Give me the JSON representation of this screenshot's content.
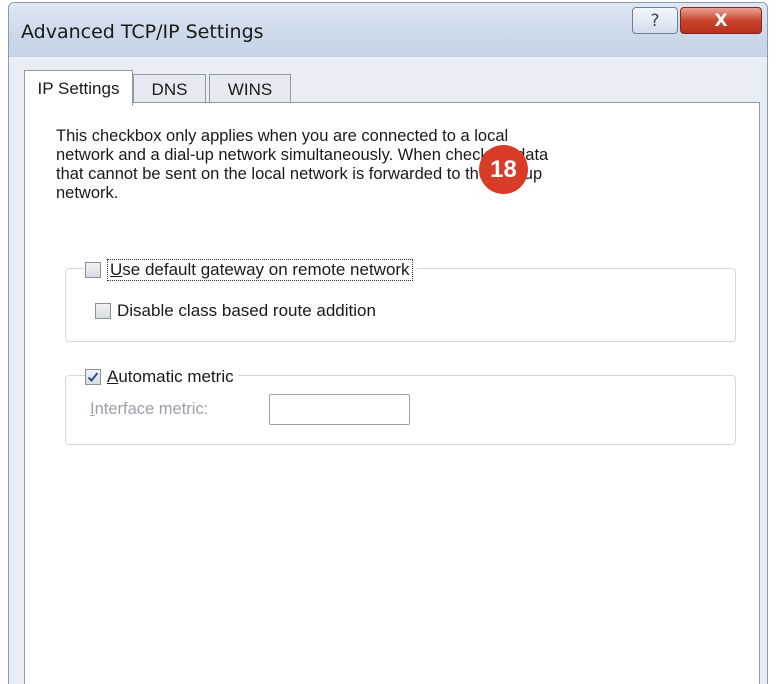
{
  "window": {
    "title": "Advanced TCP/IP Settings"
  },
  "title_buttons": {
    "help_glyph": "?",
    "close_glyph": "X"
  },
  "tabs": [
    {
      "label": "IP Settings",
      "active": true
    },
    {
      "label": "DNS",
      "active": false
    },
    {
      "label": "WINS",
      "active": false
    }
  ],
  "description": "This checkbox only applies when you are connected to a local\nnetwork and a dial-up network simultaneously.  When checked, data\nthat cannot be sent on the local network is forwarded to the dial-up\nnetwork.",
  "gateway_group": {
    "use_default_gateway": {
      "pre": "",
      "mnemonic": "U",
      "post": "se default gateway on remote network",
      "checked": false
    },
    "disable_class_route": {
      "label": "Disable class based route addition",
      "checked": false
    }
  },
  "metric_group": {
    "automatic_metric": {
      "pre": "",
      "mnemonic": "A",
      "post": "utomatic metric",
      "checked": true
    },
    "interface_metric": {
      "pre": "",
      "mnemonic": "I",
      "post": "nterface metric:",
      "value": ""
    }
  },
  "annotation_badge": "18",
  "colors": {
    "badge": "#d93c26",
    "close_button": "#c9452f"
  }
}
